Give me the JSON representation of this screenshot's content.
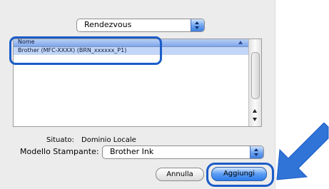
{
  "service_popup": {
    "value": "Rendezvous"
  },
  "printer_list": {
    "column_header": "Nome",
    "rows": [
      {
        "name": "Brother (MFC-XXXX) (BRN_xxxxxx_P1)"
      }
    ]
  },
  "location": {
    "label": "Situato:",
    "value": "Dominio Locale"
  },
  "model": {
    "label": "Modello Stampante:",
    "value": "Brother Ink"
  },
  "buttons": {
    "cancel": "Annulla",
    "add": "Aggiungi"
  },
  "colors": {
    "highlight_border": "#1b5cc8",
    "arrow": "#2f74d6",
    "selection": "#c3d6f7"
  }
}
